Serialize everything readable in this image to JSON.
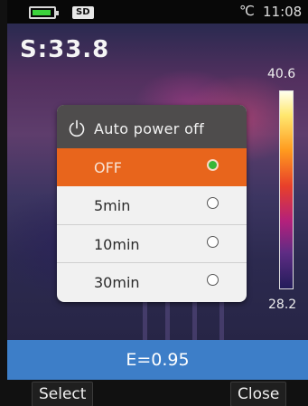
{
  "status_bar": {
    "sd_label": "SD",
    "unit": "℃",
    "time": "11:08",
    "battery_icon": "battery-icon",
    "battery_color": "#3cd23c"
  },
  "thermal_view": {
    "spot_temp": "S:33.8",
    "scale_max": "40.6",
    "scale_min": "28.2"
  },
  "dialog": {
    "title": "Auto power off",
    "icon": "power-icon",
    "options": [
      {
        "label": "OFF",
        "selected": true
      },
      {
        "label": "5min",
        "selected": false
      },
      {
        "label": "10min",
        "selected": false
      },
      {
        "label": "30min",
        "selected": false
      }
    ],
    "accent_color": "#e8651c"
  },
  "emissivity": "E=0.95",
  "softkeys": {
    "left": "Select",
    "right": "Close"
  }
}
